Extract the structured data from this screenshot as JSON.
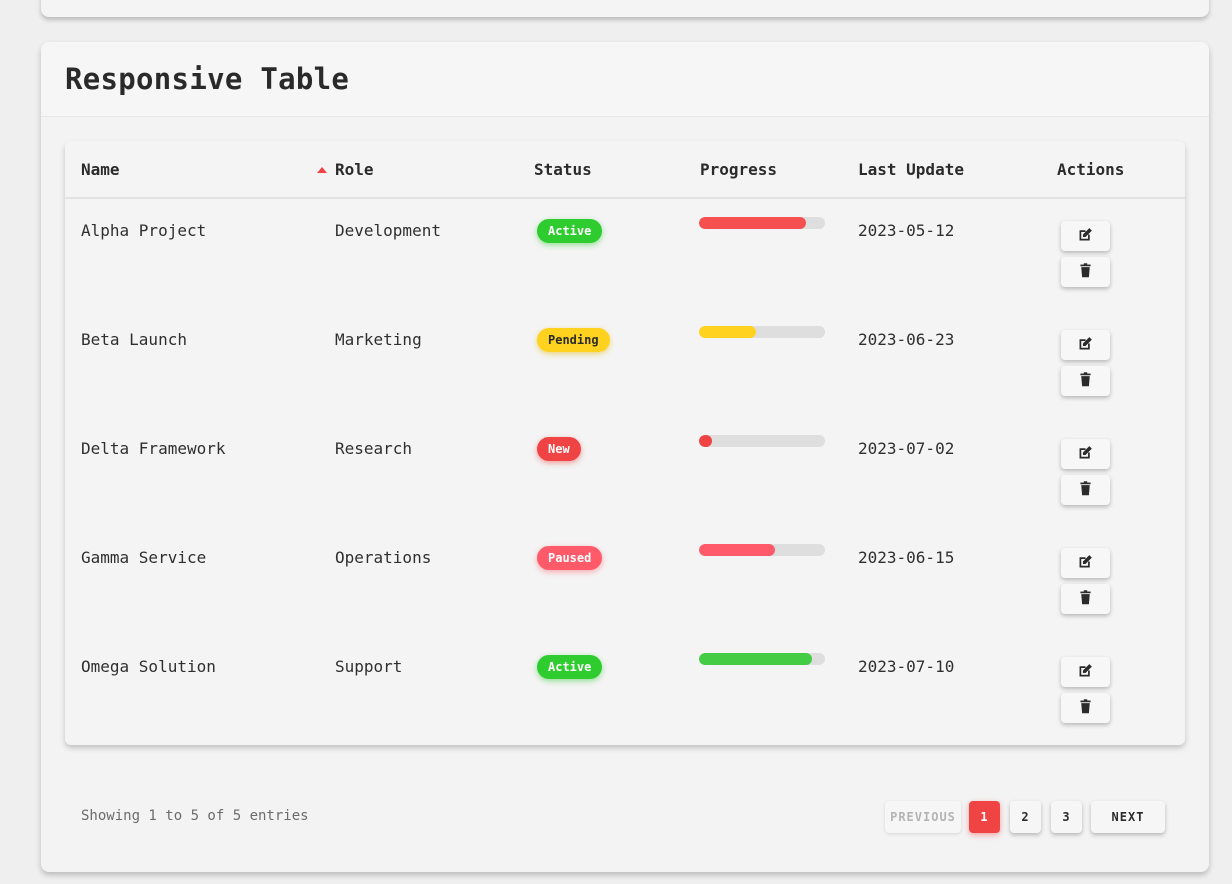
{
  "card": {
    "title": "Responsive Table"
  },
  "table": {
    "columns": [
      "Name",
      "Role",
      "Status",
      "Progress",
      "Last Update",
      "Actions"
    ],
    "sorted_column": "Name",
    "sort_direction": "ascending",
    "rows": [
      {
        "name": "Alpha Project",
        "role": "Development",
        "status": "Active",
        "status_type": "active",
        "progress": 0.85,
        "progress_color": "#f5504f",
        "last_update": "2023-05-12"
      },
      {
        "name": "Beta Launch",
        "role": "Marketing",
        "status": "Pending",
        "status_type": "pending",
        "progress": 0.45,
        "progress_color": "#ffd21f",
        "last_update": "2023-06-23"
      },
      {
        "name": "Delta Framework",
        "role": "Research",
        "status": "New",
        "status_type": "new",
        "progress": 0.1,
        "progress_color": "#f04343",
        "last_update": "2023-07-02"
      },
      {
        "name": "Gamma Service",
        "role": "Operations",
        "status": "Paused",
        "status_type": "paused",
        "progress": 0.6,
        "progress_color": "#ff5a6a",
        "last_update": "2023-06-15"
      },
      {
        "name": "Omega Solution",
        "role": "Support",
        "status": "Active",
        "status_type": "active",
        "progress": 0.9,
        "progress_color": "#44cc44",
        "last_update": "2023-07-10"
      }
    ],
    "row_actions": {
      "edit_icon": "edit-icon",
      "delete_icon": "trash-icon"
    }
  },
  "footer": {
    "info": "Showing 1 to 5 of 5 entries",
    "pagination": {
      "previous": "PREVIOUS",
      "next": "NEXT",
      "pages": [
        "1",
        "2",
        "3"
      ],
      "current": "1"
    }
  },
  "colors": {
    "accent": "#f04343",
    "active": "#2ecc2e",
    "pending": "#ffd21f",
    "paused": "#ff5a6a"
  }
}
